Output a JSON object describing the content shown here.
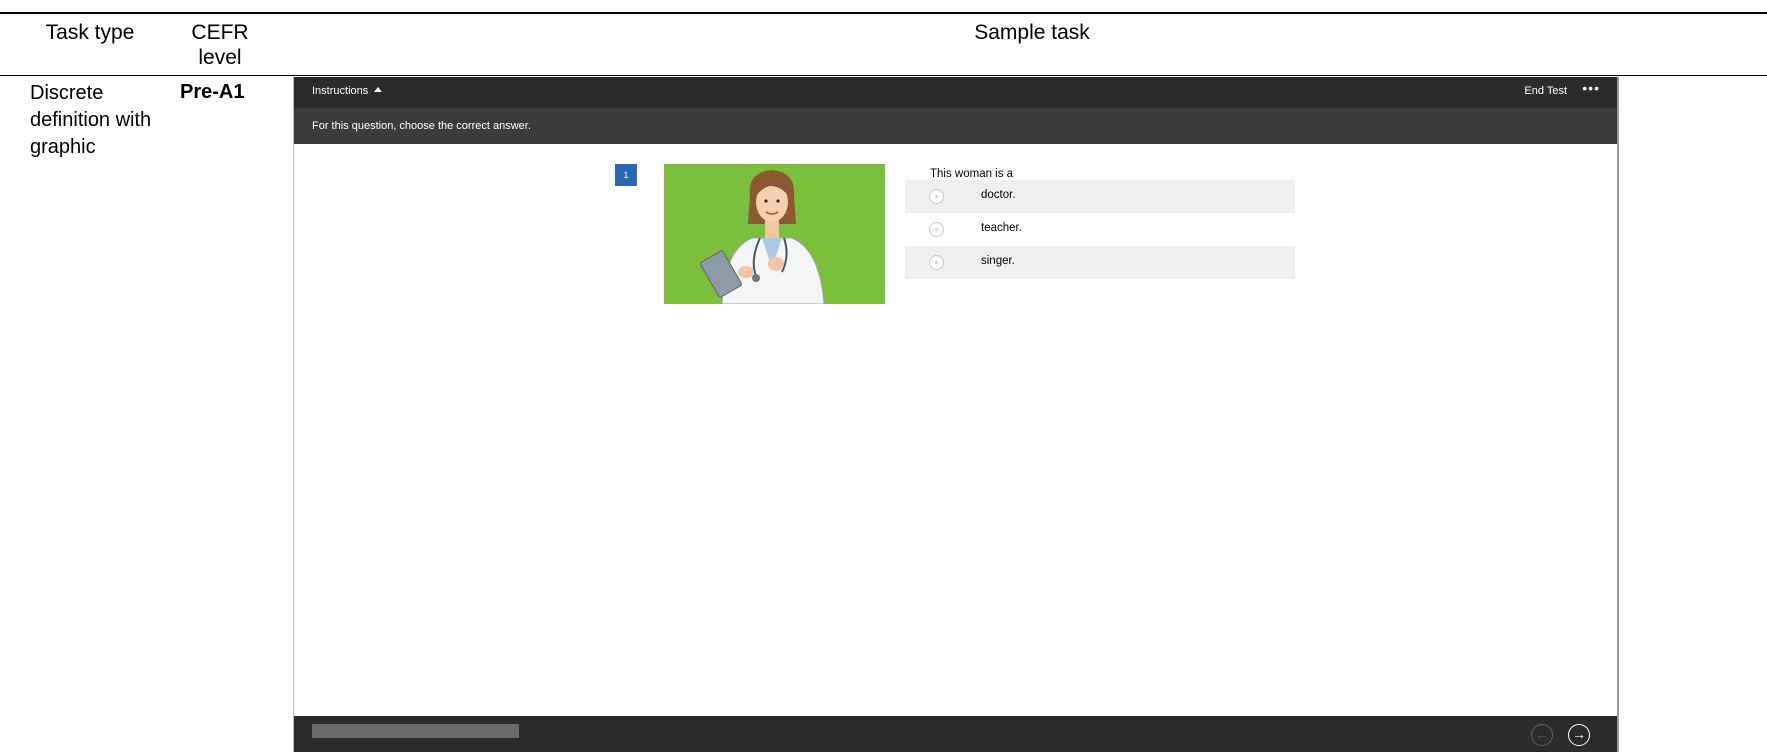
{
  "table": {
    "headers": {
      "task_type": "Task type",
      "cefr_level": "CEFR level",
      "sample_task": "Sample task"
    },
    "row": {
      "task_type": "Discrete definition with graphic",
      "cefr_level": "Pre-A1"
    }
  },
  "test": {
    "instructions_label": "Instructions",
    "end_test_label": "End Test",
    "more_label": "•••",
    "instruction_text": "For this question, choose the correct answer.",
    "question_number": "1",
    "stem": "This woman is a",
    "options": [
      "doctor.",
      "teacher.",
      "singer."
    ],
    "prev_icon": "arrow-left-circle-icon",
    "next_icon": "arrow-right-circle-icon",
    "colors": {
      "bar": "#2b2b2b",
      "accent": "#2d67b3",
      "image_bg": "#7cbf3c"
    }
  }
}
